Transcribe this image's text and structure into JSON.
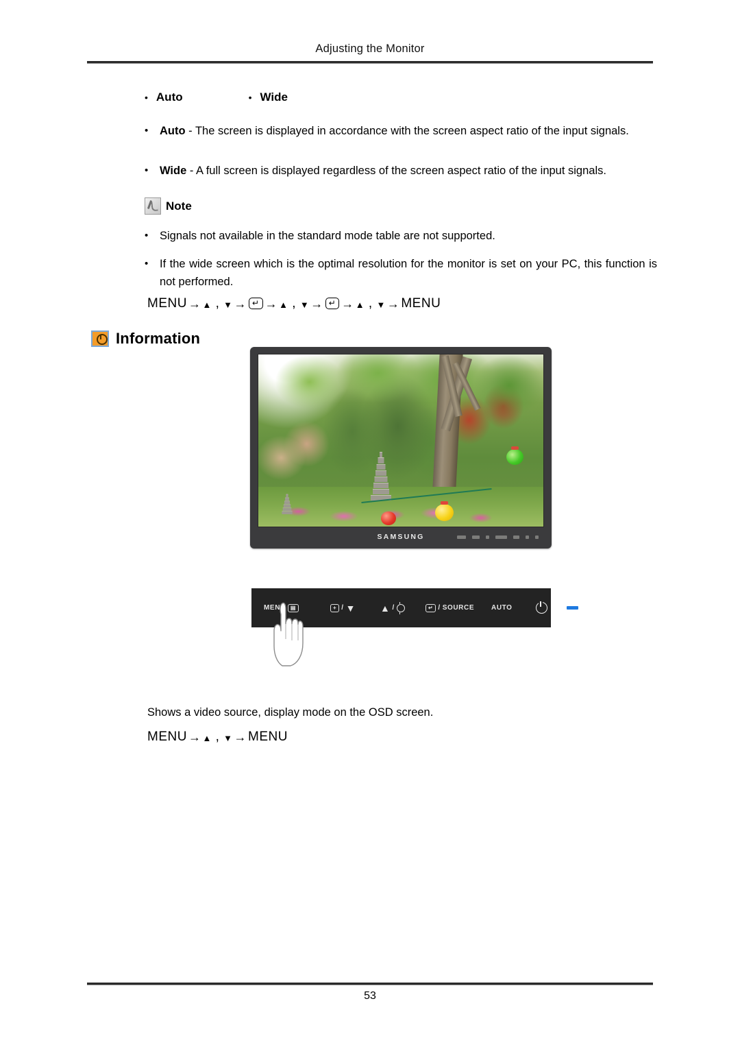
{
  "header": {
    "title": "Adjusting the Monitor"
  },
  "options_inline": [
    {
      "label": "Auto"
    },
    {
      "label": "Wide"
    }
  ],
  "descriptions": [
    {
      "term": "Auto",
      "separator": " - ",
      "text": "The screen is displayed in accordance with the screen aspect ratio of the input signals."
    },
    {
      "term": "Wide",
      "separator": " - ",
      "text": "A full screen is displayed regardless of the screen aspect ratio of the input signals."
    }
  ],
  "note": {
    "icon": "note-pencil-icon",
    "label": "Note",
    "items": [
      "Signals not available in the standard mode table are not supported.",
      "If the wide screen which is the optimal resolution for the monitor is set on your PC, this function is not performed."
    ]
  },
  "menu_path_top": {
    "start": "MENU",
    "arrow": "→",
    "up": "▲",
    "comma": " , ",
    "down": "▼",
    "enter": "↵",
    "end": "MENU"
  },
  "information": {
    "icon": "information-clock-icon",
    "title": "Information",
    "icon_color": "#f39c2a",
    "icon_border_color": "#7ba7d7"
  },
  "monitor": {
    "brand": "SAMSUNG",
    "screen_alt": "garden scene with stone pagodas, trees and paper lanterns"
  },
  "control_panel": {
    "menu_label": "MENU",
    "menu_key": "▤",
    "minus_key": "+",
    "down_arrow": "▼",
    "up_arrow": "▲",
    "brightness_icon": "sun-icon",
    "enter_key": "↵",
    "source_label": "SOURCE",
    "auto_label": "AUTO",
    "power_icon": "power-icon",
    "led_color": "#1e7ae0",
    "separator": "/"
  },
  "caption": "Shows a video source, display mode on the OSD screen.",
  "menu_path_bottom": {
    "start": "MENU",
    "arrow": "→",
    "up": "▲",
    "comma": " , ",
    "down": "▼",
    "end": "MENU"
  },
  "footer": {
    "page_number": "53"
  }
}
